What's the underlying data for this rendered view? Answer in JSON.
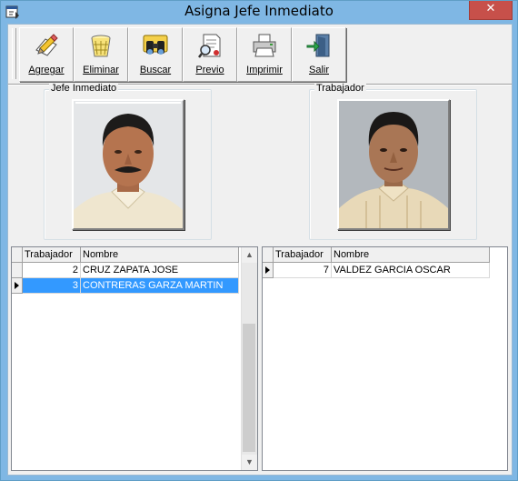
{
  "window": {
    "title": "Asigna Jefe Inmediato",
    "close_glyph": "✕"
  },
  "toolbar": {
    "buttons": [
      {
        "label": "Agregar",
        "icon": "pencil-edit-icon"
      },
      {
        "label": "Eliminar",
        "icon": "wastebasket-icon"
      },
      {
        "label": "Buscar",
        "icon": "binoculars-icon"
      },
      {
        "label": "Previo",
        "icon": "document-preview-icon"
      },
      {
        "label": "Imprimir",
        "icon": "printer-icon"
      },
      {
        "label": "Salir",
        "icon": "exit-door-icon"
      }
    ]
  },
  "jefe": {
    "group_label": "Jefe Inmediato",
    "photo_icon": "person-photo"
  },
  "trabajador": {
    "group_label": "Trabajador",
    "photo_icon": "person-photo"
  },
  "left_grid": {
    "columns": [
      "Trabajador",
      "Nombre"
    ],
    "rows": [
      {
        "id": "2",
        "name": "CRUZ ZAPATA JOSE",
        "selected": false
      },
      {
        "id": "3",
        "name": "CONTRERAS GARZA MARTIN",
        "selected": true
      }
    ],
    "scroll_up": "▲",
    "scroll_down": "▼"
  },
  "right_grid": {
    "columns": [
      "Trabajador",
      "Nombre"
    ],
    "rows": [
      {
        "id": "7",
        "name": "VALDEZ GARCIA OSCAR",
        "selected": true
      }
    ]
  },
  "colors": {
    "titlebar": "#7fb7e4",
    "selection": "#3399ff",
    "close": "#c7504a"
  }
}
